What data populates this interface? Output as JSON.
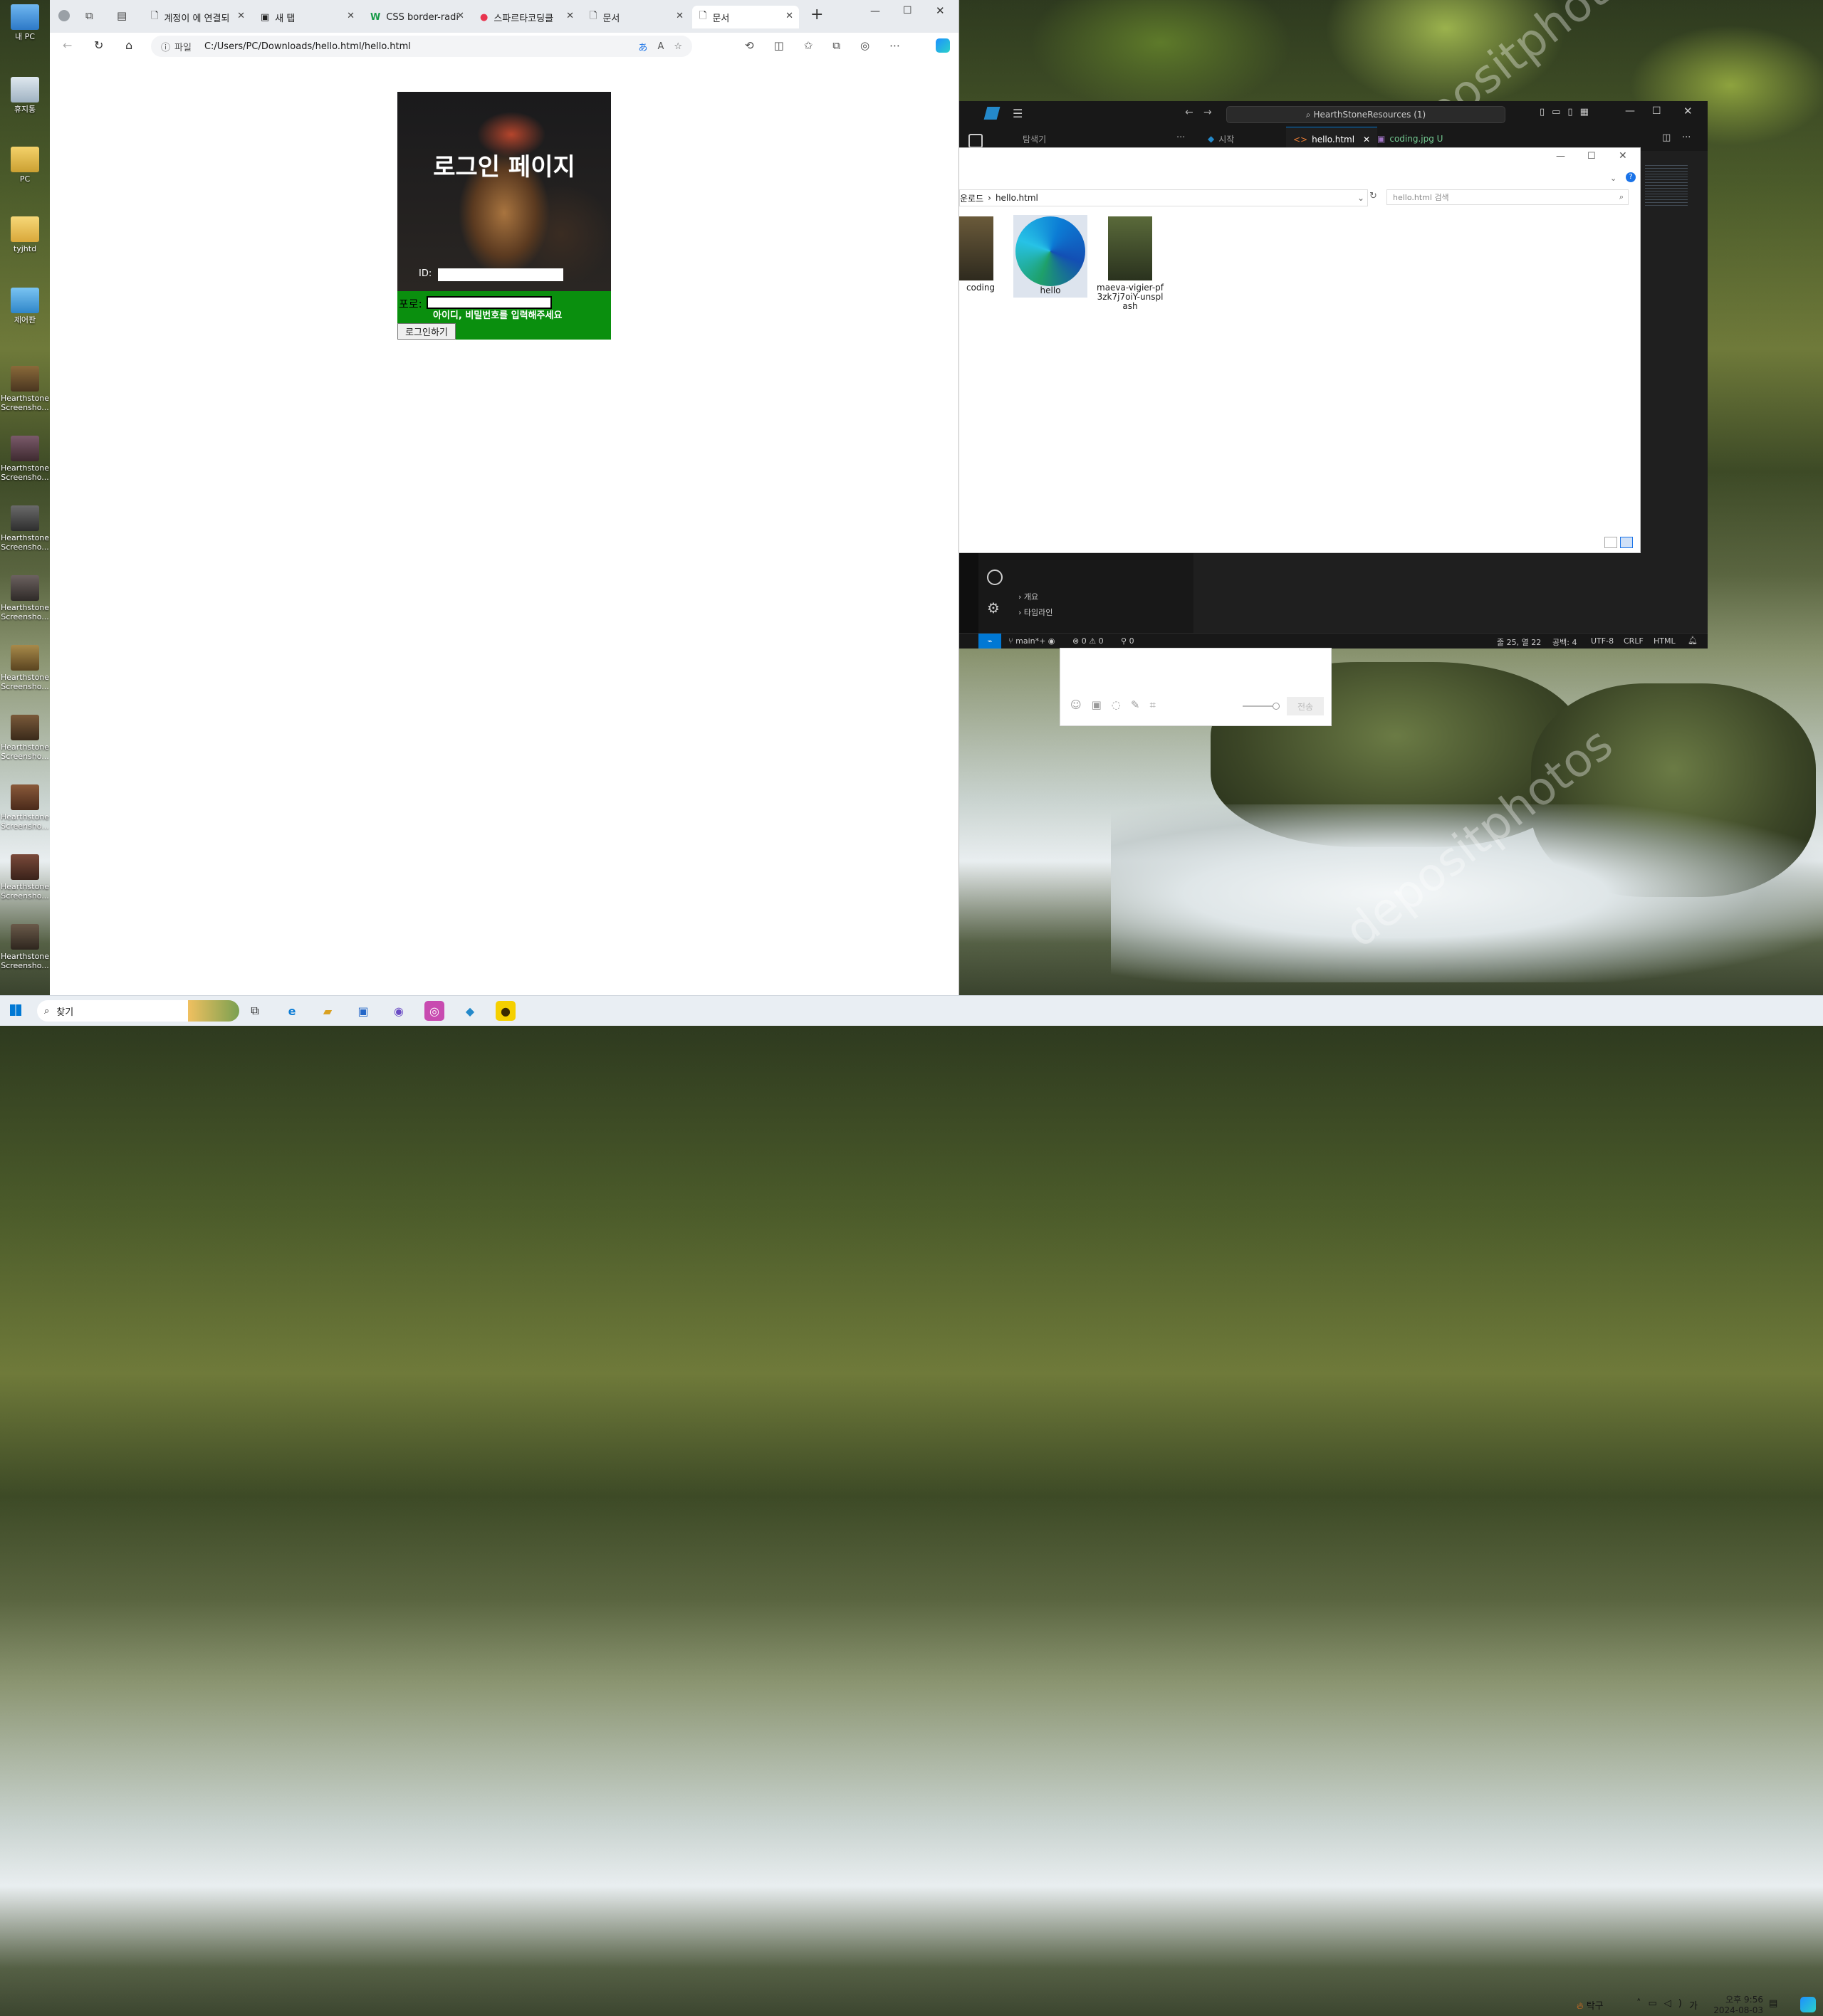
{
  "desktop": {
    "icons": [
      {
        "label": "내 PC"
      },
      {
        "label": "휴지통"
      },
      {
        "label": "PC"
      },
      {
        "label": "tyjhtd"
      },
      {
        "label": "제어판"
      },
      {
        "label": "Hearthstone Screensho..."
      },
      {
        "label": "Hearthstone Screensho..."
      },
      {
        "label": "Hearthstone Screensho..."
      },
      {
        "label": "Hearthstone Screensho..."
      },
      {
        "label": "Hearthstone Screensho..."
      },
      {
        "label": "Hearthstone Screensho..."
      },
      {
        "label": "Hearthstone Screensho..."
      },
      {
        "label": "Hearthstone Screensho..."
      },
      {
        "label": "Hearthstone Screensho..."
      }
    ],
    "watermark": "depositphotos"
  },
  "browser": {
    "tabs": [
      {
        "label": "계정이 에 연결되"
      },
      {
        "label": "새 탭"
      },
      {
        "label": "CSS border-radi"
      },
      {
        "label": "스파르타코딩클"
      },
      {
        "label": "문서"
      },
      {
        "label": "문서"
      }
    ],
    "new_tab": "+",
    "address_prefix": "파일",
    "url": "C:/Users/PC/Downloads/hello.html/hello.html"
  },
  "login_page": {
    "title": "로그인 페이지",
    "id_label": "ID:",
    "pw_label": "포로:",
    "message": "아이디, 비밀번호를 입력해주세요",
    "button": "로그인하기"
  },
  "vscode": {
    "search": "HearthStoneResources (1)",
    "tabs": [
      {
        "label": "탐색기"
      },
      {
        "label": "시작"
      },
      {
        "label": "hello.html"
      },
      {
        "label": "coding.jpg U"
      }
    ],
    "outline": [
      "개요",
      "타임라인"
    ],
    "status": {
      "branch": "main*+",
      "errors": "0",
      "warnings": "0",
      "ports": "0",
      "position": "줄 25, 열 22",
      "spaces": "공백: 4",
      "encoding": "UTF-8",
      "eol": "CRLF",
      "lang": "HTML"
    }
  },
  "explorer": {
    "path": [
      "운로드",
      "hello.html"
    ],
    "search_placeholder": "hello.html 검색",
    "files": [
      {
        "name": "coding"
      },
      {
        "name": "hello"
      },
      {
        "name": "maeva-vigier-pf3zk7j7oiY-unsplash"
      }
    ]
  },
  "chat": {
    "send": "전송"
  },
  "taskbar": {
    "search": "찾기",
    "weather": "탁구",
    "ime": "가",
    "time": "오후 9:56",
    "date": "2024-08-03"
  },
  "colors": {
    "login_green": "#0a8f0e",
    "vscode_bg": "#1f1f1f",
    "edge_accent": "#0c7cd5"
  }
}
